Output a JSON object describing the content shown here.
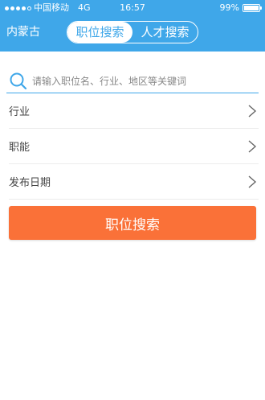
{
  "status_bar": {
    "carrier": "中国移动",
    "network": "4G",
    "time": "16:57",
    "battery": "99%",
    "battery_level": 0.99,
    "signal_bars_filled": 4
  },
  "nav": {
    "city": "内蒙古",
    "tabs": [
      {
        "label": "职位搜索",
        "active": true
      },
      {
        "label": "人才搜索",
        "active": false
      }
    ]
  },
  "search": {
    "placeholder": "请输入职位名、行业、地区等关键词",
    "value": ""
  },
  "filters": [
    {
      "label": "行业"
    },
    {
      "label": "职能"
    },
    {
      "label": "发布日期"
    }
  ],
  "submit": {
    "label": "职位搜索"
  },
  "colors": {
    "header": "#3fa7e9",
    "accent": "#3fa7e9",
    "button": "#fa7138",
    "background": "#ffffff"
  },
  "icons": {
    "search": "search-icon",
    "chevron": "chevron-right-icon",
    "battery": "battery-icon",
    "signal": "signal-dots-icon"
  }
}
